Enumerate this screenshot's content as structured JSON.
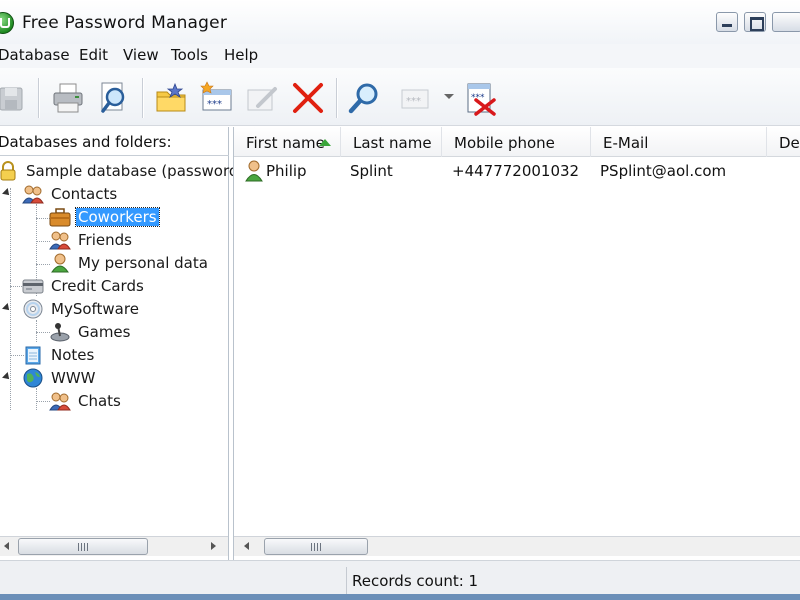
{
  "window": {
    "title": "Free Password Manager"
  },
  "menu": [
    "Database",
    "Edit",
    "View",
    "Tools",
    "Help"
  ],
  "toolbar": {
    "buttons": [
      {
        "icon": "save-icon",
        "enabled": false
      },
      {
        "icon": "printer-icon",
        "enabled": true
      },
      {
        "icon": "print-preview-icon",
        "enabled": true
      },
      {
        "icon": "new-folder-icon",
        "enabled": true
      },
      {
        "icon": "new-record-icon",
        "enabled": true
      },
      {
        "icon": "edit-record-icon",
        "enabled": false
      },
      {
        "icon": "delete-icon",
        "enabled": true
      },
      {
        "icon": "find-icon",
        "enabled": true
      },
      {
        "icon": "copy-password-icon",
        "enabled": false
      },
      {
        "icon": "clear-clipboard-icon",
        "enabled": true
      }
    ]
  },
  "left_pane": {
    "caption": "Databases and folders:",
    "tree": [
      {
        "label": "Sample database (password:",
        "icon": "lock-icon",
        "level": 0
      },
      {
        "label": "Contacts",
        "icon": "people-icon",
        "level": 1,
        "expanded": true
      },
      {
        "label": "Coworkers",
        "icon": "briefcase-icon",
        "level": 2,
        "selected": true
      },
      {
        "label": "Friends",
        "icon": "people-icon",
        "level": 2
      },
      {
        "label": "My personal data",
        "icon": "person-icon",
        "level": 2
      },
      {
        "label": "Credit Cards",
        "icon": "credit-card-icon",
        "level": 1
      },
      {
        "label": "MySoftware",
        "icon": "cd-icon",
        "level": 1,
        "expanded": true
      },
      {
        "label": "Games",
        "icon": "joystick-icon",
        "level": 2
      },
      {
        "label": "Notes",
        "icon": "notepad-icon",
        "level": 1
      },
      {
        "label": "WWW",
        "icon": "globe-icon",
        "level": 1,
        "expanded": true
      },
      {
        "label": "Chats",
        "icon": "people-icon",
        "level": 2
      }
    ]
  },
  "list": {
    "columns": [
      "First name",
      "Last name",
      "Mobile phone",
      "E-Mail",
      "Des"
    ],
    "sorted_column": "First name",
    "rows": [
      {
        "icon": "person-icon",
        "cells": [
          "Philip",
          "Splint",
          "+447772001032",
          "PSplint@aol.com",
          ""
        ]
      }
    ]
  },
  "scrollbar_glyph": "III",
  "status": {
    "records": "Records count: 1"
  },
  "colors": {
    "selection": "#3399ff",
    "sort_arrow": "#3aa53a",
    "delete_red": "#e02010"
  }
}
